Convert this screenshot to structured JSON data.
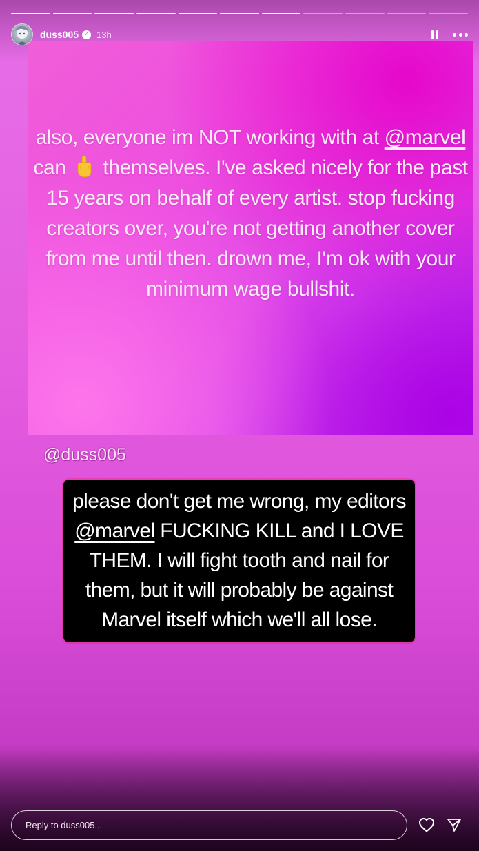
{
  "story": {
    "progress": {
      "total_segments": 11,
      "completed_segments": 7
    },
    "header": {
      "username": "duss005",
      "time": "13h",
      "verified": true
    },
    "icons": {
      "pause": "pause-icon",
      "more": "more-icon",
      "heart": "heart-icon",
      "send": "send-icon",
      "hand": "middle-finger-emoji"
    },
    "post": {
      "line1_pre": "also, everyone im NOT working with at ",
      "line1_mention": "@marvel",
      "line2_pre": "can",
      "line2_post": "themselves. I've asked nicely for the past 15 years on behalf of every artist. stop fucking creators over, you're not getting another cover from me until then. drown me, I'm ok with your minimum wage bullshit."
    },
    "mention_tag": "@duss005",
    "caption": {
      "pre": "please don't get me wrong, my editors ",
      "mention": "@marvel",
      "post": " FUCKING KILL and I LOVE THEM. I will fight tooth and nail for them, but it will probably be against Marvel itself which we'll all lose."
    },
    "reply": {
      "placeholder": "Reply to duss005..."
    }
  },
  "colors": {
    "background": "#e55ee0",
    "caption_bg": "#000000",
    "text": "#ffffff"
  }
}
